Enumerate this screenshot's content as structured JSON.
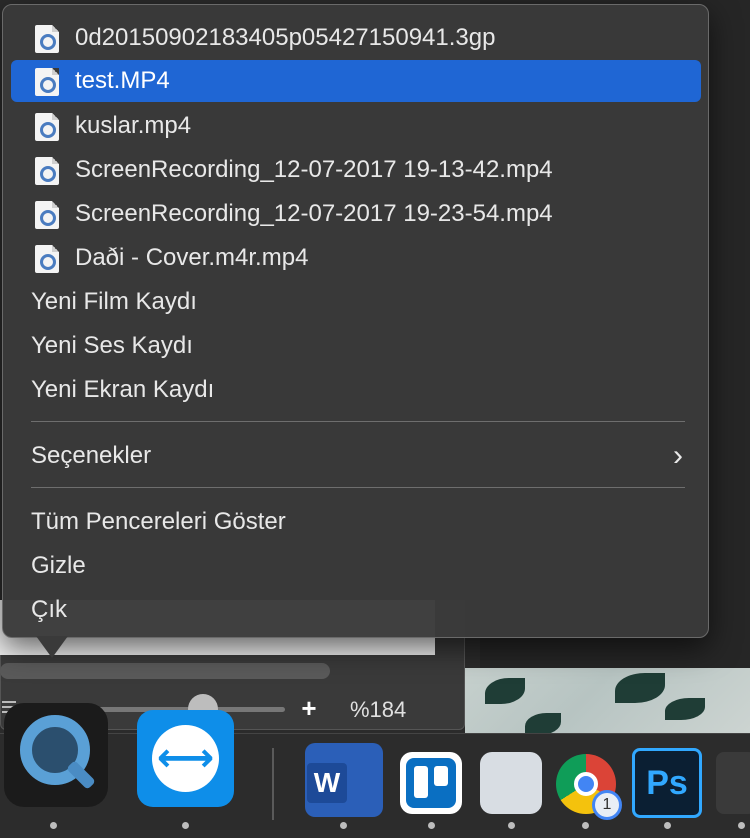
{
  "menu": {
    "recent_files": [
      {
        "label": "0d20150902183405p05427150941.3gp",
        "selected": false
      },
      {
        "label": "test.MP4",
        "selected": true
      },
      {
        "label": "kuslar.mp4",
        "selected": false
      },
      {
        "label": "ScreenRecording_12-07-2017 19-13-42.mp4",
        "selected": false
      },
      {
        "label": "ScreenRecording_12-07-2017 19-23-54.mp4",
        "selected": false
      },
      {
        "label": "Daði - Cover.m4r.mp4",
        "selected": false
      }
    ],
    "new_movie": "Yeni Film Kaydı",
    "new_audio": "Yeni Ses Kaydı",
    "new_screen": "Yeni Ekran Kaydı",
    "options": "Seçenekler",
    "options_chevron": "›",
    "show_all_windows": "Tüm Pencereleri Göster",
    "hide": "Gizle",
    "quit": "Çık"
  },
  "player": {
    "zoom": "%184",
    "plus": "+"
  },
  "dock": {
    "word_letter": "W",
    "ps_letters": "Ps",
    "chrome_badge": "1",
    "teamviewer_arrow": "⟷"
  },
  "colors": {
    "selection": "#1f66d4",
    "menu_bg": "#3a3a3a"
  }
}
